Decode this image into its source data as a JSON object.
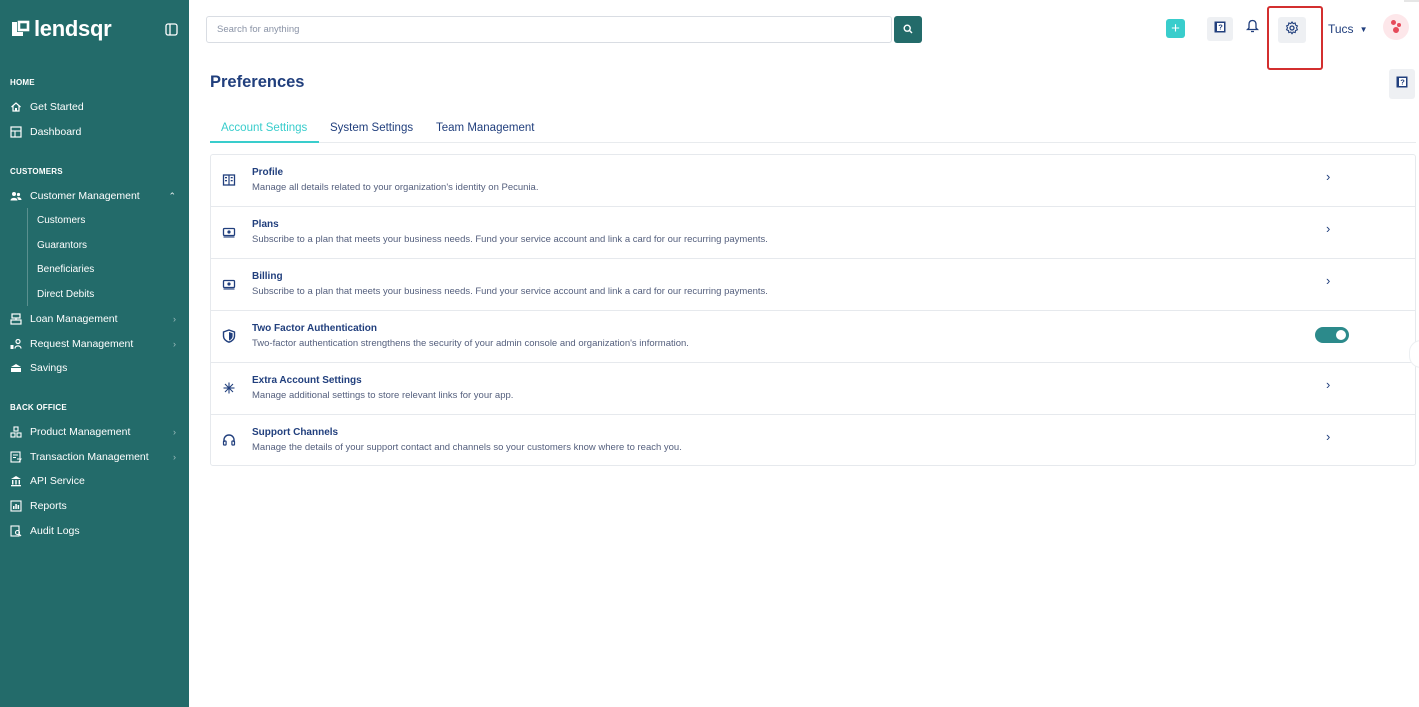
{
  "brand": {
    "name": "lendsqr"
  },
  "sidebar": {
    "sections": {
      "home": "HOME",
      "customers": "CUSTOMERS",
      "back_office": "BACK OFFICE"
    },
    "home_items": [
      {
        "label": "Get Started",
        "icon": "home-icon"
      },
      {
        "label": "Dashboard",
        "icon": "dashboard-icon"
      }
    ],
    "customer_management": {
      "label": "Customer Management",
      "icon": "users-icon",
      "expanded": true
    },
    "customer_sub_items": [
      "Customers",
      "Guarantors",
      "Beneficiaries",
      "Direct Debits"
    ],
    "customer_items": [
      {
        "label": "Loan Management",
        "icon": "loan-icon"
      },
      {
        "label": "Request Management",
        "icon": "request-icon"
      },
      {
        "label": "Savings",
        "icon": "savings-icon"
      }
    ],
    "back_office_items": [
      {
        "label": "Product Management",
        "icon": "product-icon"
      },
      {
        "label": "Transaction Management",
        "icon": "transaction-icon"
      },
      {
        "label": "API Service",
        "icon": "bank-icon"
      },
      {
        "label": "Reports",
        "icon": "reports-icon"
      },
      {
        "label": "Audit Logs",
        "icon": "audit-icon"
      }
    ]
  },
  "header": {
    "search": {
      "placeholder": "Search for anything",
      "value": ""
    },
    "user": {
      "name": "Tucs"
    }
  },
  "page": {
    "title": "Preferences",
    "tabs": [
      {
        "label": "Account Settings",
        "active": true
      },
      {
        "label": "System Settings",
        "active": false
      },
      {
        "label": "Team Management",
        "active": false
      }
    ],
    "settings": [
      {
        "title": "Profile",
        "description": "Manage all details related to your organization's identity on Pecunia.",
        "icon": "building-icon",
        "control": "chevron"
      },
      {
        "title": "Plans",
        "description": "Subscribe to a plan that meets your business needs. Fund your service account and link a card for our recurring payments.",
        "icon": "money-icon",
        "control": "chevron"
      },
      {
        "title": "Billing",
        "description": "Subscribe to a plan that meets your business needs. Fund your service account and link a card for our recurring payments.",
        "icon": "money-icon",
        "control": "chevron"
      },
      {
        "title": "Two Factor Authentication",
        "description": "Two-factor authentication strengthens the security of your admin console and organization's information.",
        "icon": "shield-icon",
        "control": "toggle",
        "enabled": true
      },
      {
        "title": "Extra Account Settings",
        "description": "Manage additional settings to store relevant links for your app.",
        "icon": "settings-network-icon",
        "control": "chevron"
      },
      {
        "title": "Support Channels",
        "description": "Manage the details of your support contact and channels so your customers know where to reach you.",
        "icon": "headset-icon",
        "control": "chevron"
      }
    ]
  },
  "colors": {
    "sidebar_bg": "#236b6a",
    "accent": "#39cdcc",
    "primary_text": "#213f7d",
    "secondary_text": "#545f7d",
    "toggle_on": "#2c8a8b",
    "highlight": "#d32f2f"
  }
}
